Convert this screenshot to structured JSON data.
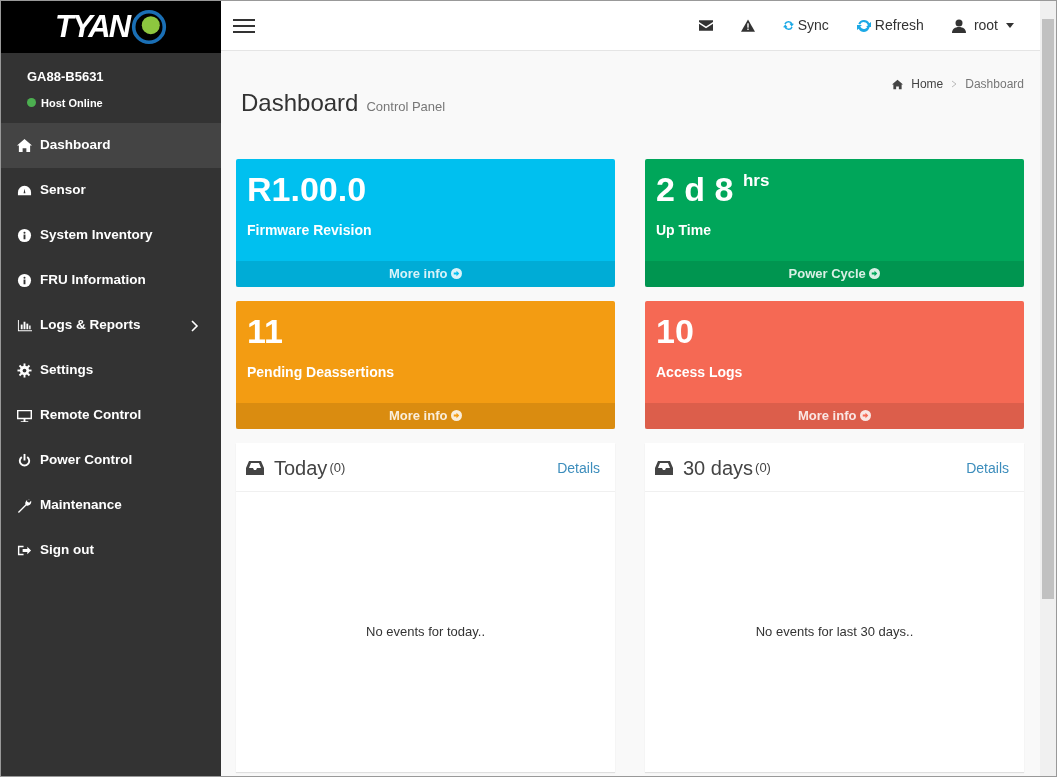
{
  "logo": {
    "text": "TYAN"
  },
  "host": {
    "name": "GA88-B5631",
    "status": "Host Online",
    "online": true
  },
  "sidebar": {
    "items": [
      {
        "label": "Dashboard",
        "selected": true
      },
      {
        "label": "Sensor",
        "selected": false
      },
      {
        "label": "System Inventory",
        "selected": false
      },
      {
        "label": "FRU Information",
        "selected": false
      },
      {
        "label": "Logs & Reports",
        "selected": false,
        "expandable": true
      },
      {
        "label": "Settings",
        "selected": false
      },
      {
        "label": "Remote Control",
        "selected": false
      },
      {
        "label": "Power Control",
        "selected": false
      },
      {
        "label": "Maintenance",
        "selected": false
      },
      {
        "label": "Sign out",
        "selected": false
      }
    ]
  },
  "topbar": {
    "sync": "Sync",
    "refresh": "Refresh",
    "user": "root"
  },
  "page": {
    "title": "Dashboard",
    "subtitle": "Control Panel"
  },
  "breadcrumb": [
    "Home",
    "Dashboard"
  ],
  "tiles": [
    {
      "value": "R1.00.0",
      "label": "Firmware Revision",
      "footer": "More info",
      "color": "#00c0ef"
    },
    {
      "value": "2 d 8 $^{hrs}$",
      "label": "Up Time",
      "footer": "Power Cycle",
      "color": "#00a65a"
    },
    {
      "value": "11",
      "label": "Pending Deassertions",
      "footer": "More info",
      "color": "#f39c12"
    },
    {
      "value": "10",
      "label": "Access Logs",
      "footer": "More info",
      "color": "#f56954"
    }
  ],
  "panels": [
    {
      "title": "Today",
      "count": "(0)",
      "link": "Details",
      "empty": "No events for today.."
    },
    {
      "title": "30 days",
      "count": "(0)",
      "link": "Details",
      "empty": "No events for last 30 days.."
    }
  ]
}
